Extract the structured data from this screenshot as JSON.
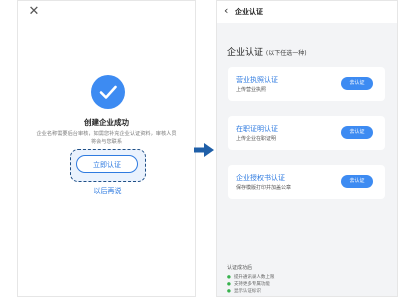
{
  "left": {
    "close_glyph": "✕",
    "success_title": "创建企业成功",
    "success_desc": "企业名称需要后台审核，如需您补充企业认证资料，审核人员将会与您联系",
    "cta_label": "立即认证",
    "later_label": "以后再说"
  },
  "right": {
    "back_glyph": "‹",
    "nav_title": "企业认证",
    "section_title": "企业认证",
    "section_hint": "(以下任选一种)",
    "cards": [
      {
        "title": "营业执照认证",
        "subtitle": "上传营业执照",
        "button": "去认证"
      },
      {
        "title": "在职证明认证",
        "subtitle": "上传企业在职证明",
        "button": "去认证"
      },
      {
        "title": "企业授权书认证",
        "subtitle": "保存模版打印并加盖公章",
        "button": "去认证"
      }
    ],
    "benefits_title": "认证成功后",
    "benefits": [
      "提升通讯录人数上限",
      "支持更多专属功能",
      "显示认证标识"
    ]
  },
  "colors": {
    "accent": "#3d8bf2",
    "link": "#2f7be0",
    "highlight_border": "#1f4f86",
    "bullet": "#37b24d"
  }
}
